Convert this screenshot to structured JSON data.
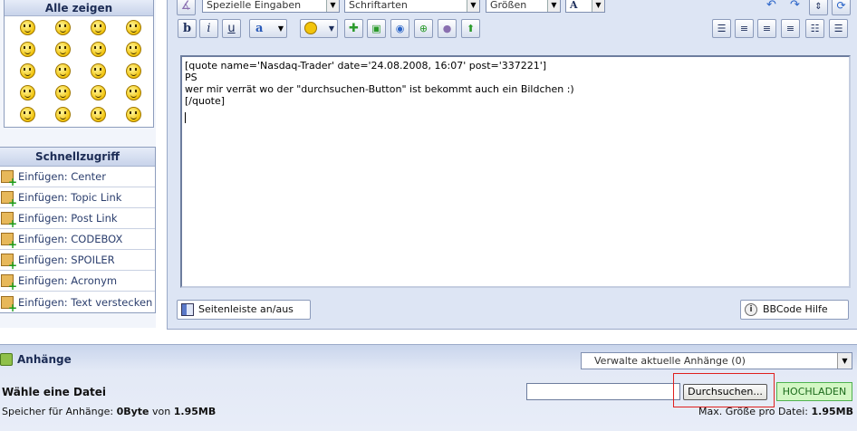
{
  "smileys": {
    "header": "Alle zeigen",
    "items": [
      "smiley-1",
      "smiley-2",
      "smiley-3",
      "smiley-4",
      "smiley-5",
      "smiley-6",
      "smiley-7",
      "smiley-8",
      "smiley-9",
      "smiley-10",
      "smiley-11",
      "smiley-12",
      "smiley-13",
      "smiley-14",
      "smiley-15",
      "smiley-16",
      "smiley-17",
      "smiley-18",
      "smiley-19",
      "smiley-20"
    ]
  },
  "quick_access": {
    "header": "Schnellzugriff",
    "items": [
      {
        "label": "Einfügen: Center"
      },
      {
        "label": "Einfügen: Topic Link"
      },
      {
        "label": "Einfügen: Post Link"
      },
      {
        "label": "Einfügen: CODEBOX"
      },
      {
        "label": "Einfügen: SPOILER"
      },
      {
        "label": "Einfügen: Acronym"
      },
      {
        "label": "Einfügen: Text verstecken"
      }
    ]
  },
  "toolbar": {
    "special_select": "Spezielle Eingaben",
    "fonts_select": "Schriftarten",
    "sizes_select": "Größen",
    "color_label": "A",
    "bold": "b",
    "italic": "i",
    "underline": "u",
    "font_style": "a",
    "icons": {
      "special": "special-chars-icon",
      "undo": "undo-icon",
      "redo": "redo-icon",
      "resize": "resize-icon",
      "swap": "swap-icon",
      "emoticon": "emoticon-icon",
      "add": "add-icon",
      "image": "image-icon",
      "media": "media-icon",
      "link": "link-icon",
      "quote": "quote-bubble-icon",
      "upload": "upload-icon",
      "indent": "indent-icon",
      "align_left": "align-left-icon",
      "align_center": "align-center-icon",
      "align_right": "align-right-icon",
      "list_numbered": "numbered-list-icon",
      "list_bulleted": "bulleted-list-icon"
    }
  },
  "editor": {
    "lines": [
      "[quote name='Nasdaq-Trader' date='24.08.2008, 16:07' post='337221']",
      "PS",
      "wer mir verrät wo der \"durchsuchen-Button\" ist bekommt auch ein Bildchen :)",
      "[/quote]"
    ]
  },
  "buttons": {
    "sidebar_toggle": "Seitenleiste an/aus",
    "bbcode_help": "BBCode Hilfe"
  },
  "attachments": {
    "title": "Anhänge",
    "manage": "Verwalte aktuelle Anhänge (0)",
    "choose_file": "Wähle eine Datei",
    "browse": "Durchsuchen...",
    "upload": "HOCHLADEN",
    "storage_prefix": "Speicher für Anhänge: ",
    "storage_used": "0Byte",
    "storage_of": " von ",
    "storage_total": "1.95MB",
    "max_prefix": "Max. Größe pro Datei: ",
    "max_value": "1.95MB"
  },
  "colors": {
    "panel_bg": "#dde5f4",
    "header_text": "#1c2c55",
    "annotation_red": "#e0201e",
    "upload_green": "#d3f7c4"
  }
}
